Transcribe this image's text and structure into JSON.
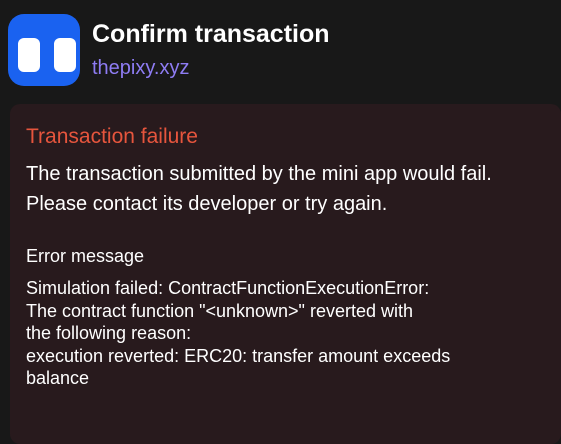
{
  "header": {
    "icon": "app-logo-icon",
    "icon_color": "#1a62f0",
    "title": "Confirm transaction",
    "domain": "thepixy.xyz",
    "domain_color": "#8e7cf3"
  },
  "error": {
    "title": "Transaction failure",
    "title_color": "#e6553d",
    "description": "The transaction submitted by the mini app would fail. Please contact its developer or try again.",
    "message_label": "Error message",
    "message_lines": [
      "Simulation failed: ContractFunctionExecutionError:",
      "The contract function \"<unknown>\" reverted with",
      "the following reason:",
      "execution reverted: ERC20: transfer amount exceeds",
      "balance"
    ]
  }
}
